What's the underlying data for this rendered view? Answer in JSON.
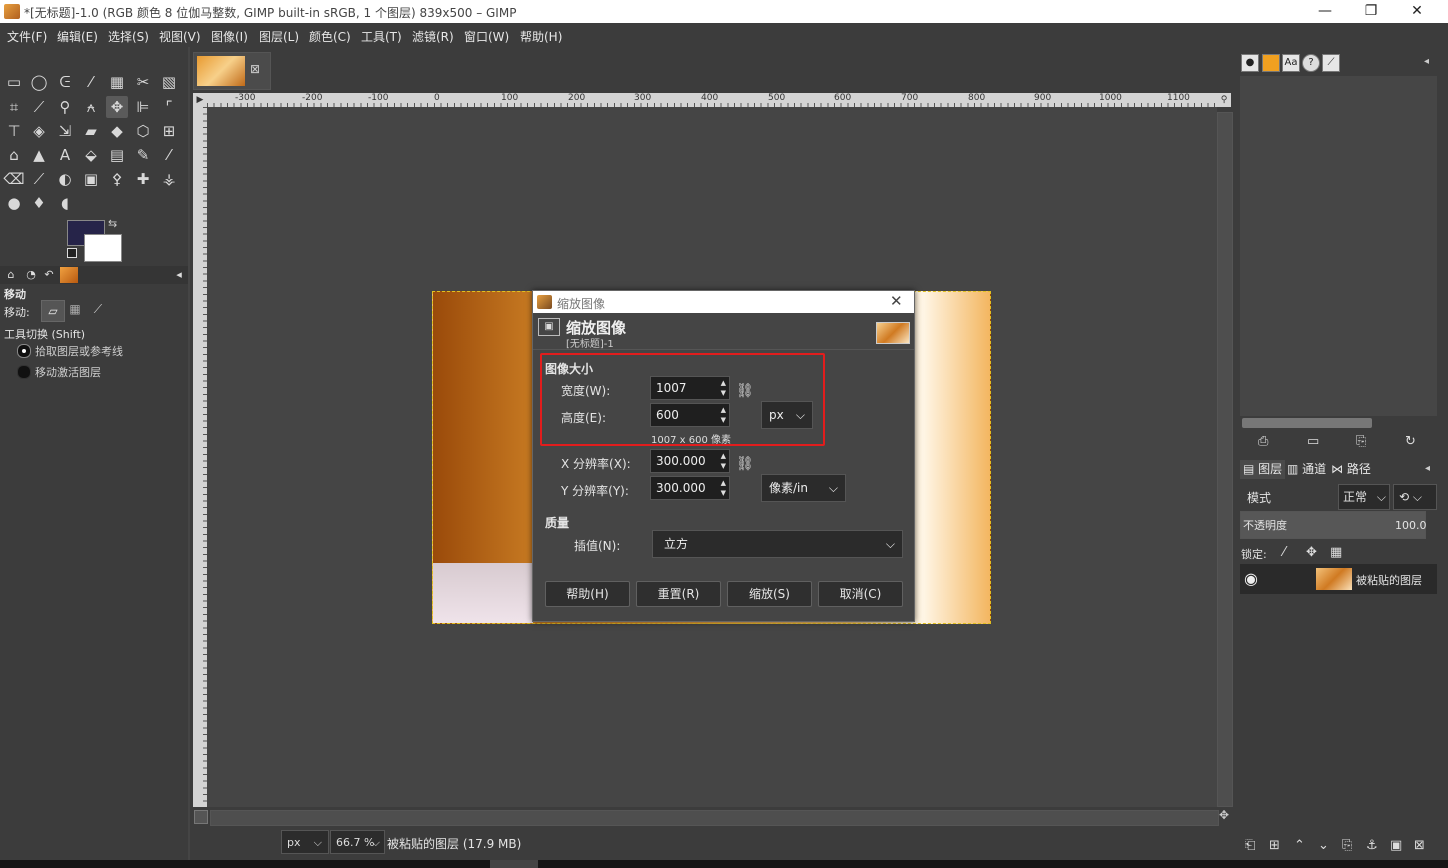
{
  "window": {
    "title": "*[无标题]-1.0 (RGB 颜色 8 位伽马整数, GIMP built-in sRGB, 1 个图层) 839x500 – GIMP",
    "min": "—",
    "max": "❐",
    "close": "✕"
  },
  "menu": [
    "文件(F)",
    "编辑(E)",
    "选择(S)",
    "视图(V)",
    "图像(I)",
    "图层(L)",
    "颜色(C)",
    "工具(T)",
    "滤镜(R)",
    "窗口(W)",
    "帮助(H)"
  ],
  "tool_options": {
    "title": "移动",
    "move_label": "移动:",
    "toggle_label": "工具切换 (Shift)",
    "option1": "拾取图层或参考线",
    "option2": "移动激活图层"
  },
  "ruler": {
    "h_ticks": [
      "-300",
      "-200",
      "-100",
      "0",
      "100",
      "200",
      "300",
      "400",
      "500",
      "600",
      "700",
      "800",
      "900",
      "1000",
      "1100"
    ]
  },
  "statusbar": {
    "unit": "px",
    "zoom": "66.7 %",
    "info": "被粘贴的图层 (17.9 MB)"
  },
  "layers_panel": {
    "tabs": [
      "图层",
      "通道",
      "路径"
    ],
    "mode_label": "模式",
    "mode_value": "正常",
    "opacity_label": "不透明度",
    "opacity_value": "100.0",
    "lock_label": "锁定:",
    "layer_name": "被粘贴的图层"
  },
  "dialog": {
    "window_title": "缩放图像",
    "heading": "缩放图像",
    "subheading": "[无标题]-1",
    "section_size": "图像大小",
    "width_label": "宽度(W):",
    "width_value": "1007",
    "height_label": "高度(E):",
    "height_value": "600",
    "size_unit": "px",
    "pixel_info": "1007 x 600 像素",
    "xres_label": "X 分辨率(X):",
    "xres_value": "300.000",
    "yres_label": "Y 分辨率(Y):",
    "yres_value": "300.000",
    "res_unit": "像素/in",
    "section_quality": "质量",
    "interp_label": "插值(N):",
    "interp_value": "立方",
    "buttons": {
      "help": "帮助(H)",
      "reset": "重置(R)",
      "scale": "缩放(S)",
      "cancel": "取消(C)"
    }
  },
  "colors": {
    "foreground": "#262449",
    "background": "#ffffff",
    "highlight": "#e21d1d"
  },
  "icons": [
    "gimp-app-icon",
    "rect-select-icon",
    "ellipse-select-icon",
    "lasso-icon",
    "fuzzy-select-icon",
    "color-select-icon",
    "scissors-icon",
    "move-icon",
    "text-icon",
    "brush-icon",
    "eraser-icon",
    "eye-icon",
    "chain-icon",
    "chevron-down-icon"
  ]
}
